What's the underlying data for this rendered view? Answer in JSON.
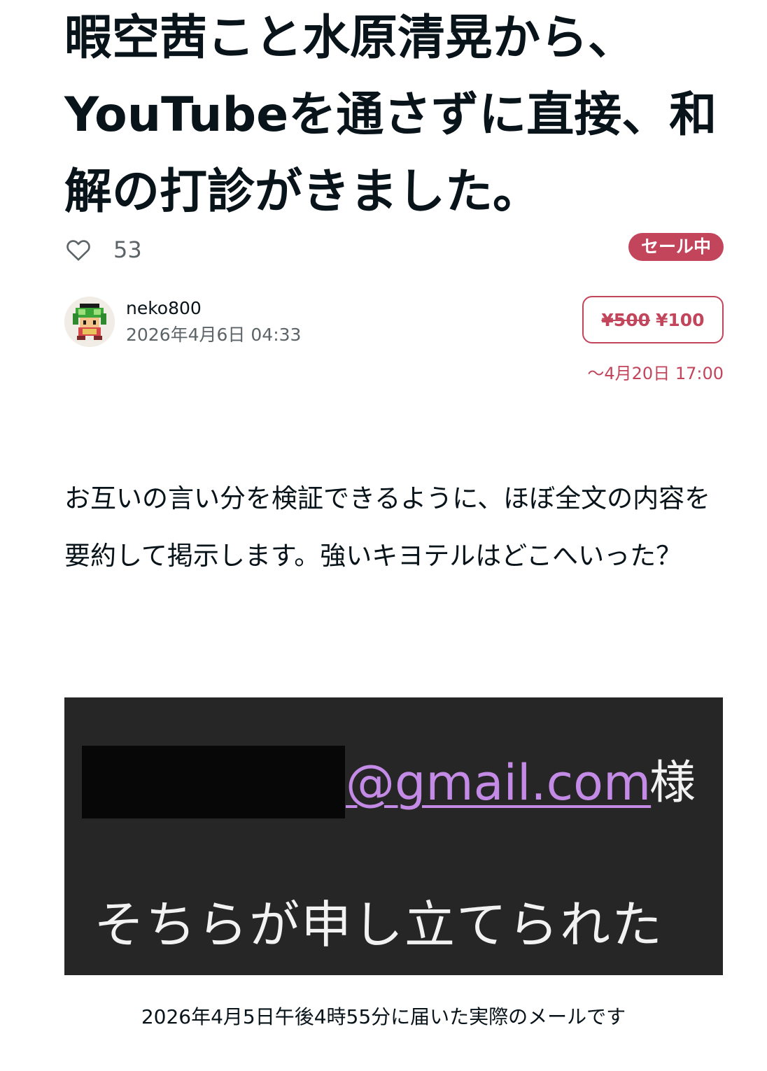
{
  "article": {
    "title": "暇空茜こと水原清晃から、YouTubeを通さずに直接、和解の打診がきました。",
    "likes": {
      "icon": "heart-outline-icon",
      "count": "53"
    },
    "sale_badge": "セール中",
    "author": {
      "name": "neko800",
      "date": "2026年4月6日 04:33",
      "avatar": "pixel-character-avatar"
    },
    "price": {
      "original": "¥500",
      "sale": "¥100",
      "until": "〜4月20日 17:00"
    },
    "body": "お互いの言い分を検証できるように、ほぼ全文の内容を要約して掲示します。強いキヨテルはどこへいった？",
    "image": {
      "email": "@gmail.com",
      "honorific": "様",
      "line": "そちらが申し立てられた",
      "caption": "2026年4月5日午後4時55分に届いた実際のメールです"
    }
  },
  "colors": {
    "accent": "#c3455c",
    "text": "#08131a",
    "muted": "#5c6468",
    "link": "#c38be6",
    "image_bg": "#262626"
  }
}
